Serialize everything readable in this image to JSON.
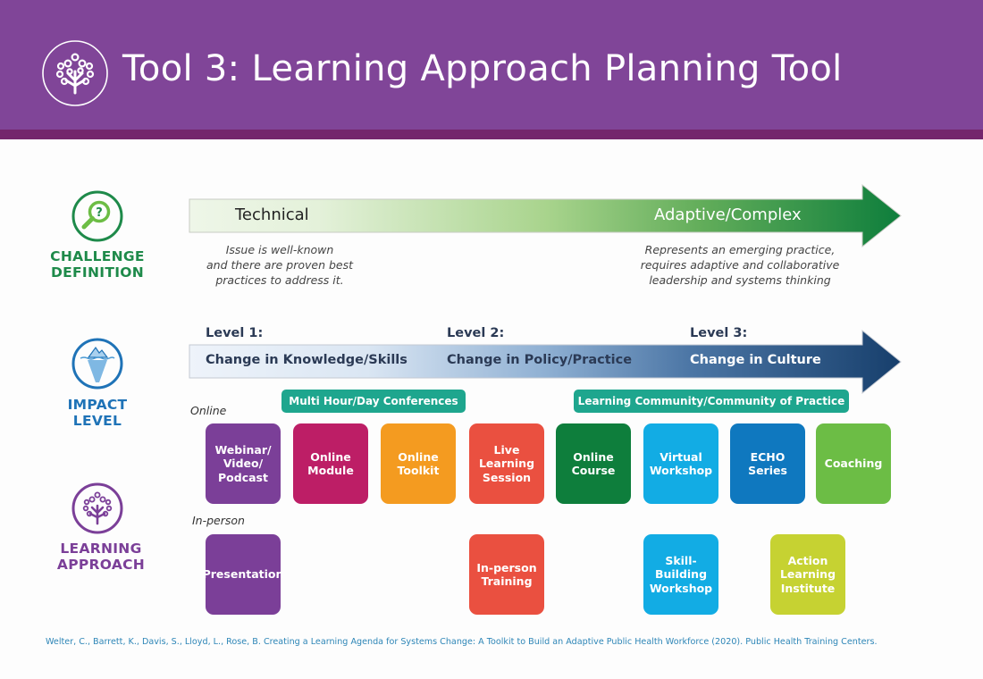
{
  "header": {
    "title": "Tool 3: Learning Approach Planning Tool",
    "logo_icon": "tree-of-gears-icon",
    "bg_color": "#804598",
    "band_color": "#74266c"
  },
  "rows": {
    "challenge": {
      "label_line1": "CHALLENGE",
      "label_line2": "DEFINITION",
      "icon": "magnifier-question-icon",
      "color": "#1e8a4a"
    },
    "impact": {
      "label_line1": "IMPACT",
      "label_line2": "LEVEL",
      "icon": "iceberg-icon",
      "color": "#1f73b7"
    },
    "learning": {
      "label_line1": "LEARNING",
      "label_line2": "APPROACH",
      "icon": "tree-of-gears-icon",
      "color": "#7b3f98"
    }
  },
  "challenge_arrow": {
    "left_label": "Technical",
    "right_label": "Adaptive/Complex",
    "left_desc": [
      "Issue is well-known",
      "and there are proven best",
      "practices to address it."
    ],
    "right_desc": [
      "Represents an emerging practice,",
      "requires adaptive and collaborative",
      "leadership and systems thinking"
    ],
    "gradient": [
      "#eef6e8",
      "#a9d48d",
      "#0e7e3c"
    ]
  },
  "impact_arrow": {
    "levels": [
      {
        "title": "Level 1:",
        "subtitle": "Change in Knowledge/Skills"
      },
      {
        "title": "Level 2:",
        "subtitle": "Change in Policy/Practice"
      },
      {
        "title": "Level 3:",
        "subtitle": "Change in Culture"
      }
    ],
    "gradient": [
      "#eef3fa",
      "#8fb0d3",
      "#173f6c"
    ]
  },
  "bands": [
    {
      "label": "Multi Hour/Day Conferences"
    },
    {
      "label": "Learning Community/Community of Practice"
    }
  ],
  "modes": {
    "online": "Online",
    "in_person": "In-person"
  },
  "online_approaches": [
    {
      "lines": [
        "Webinar/",
        "Video/",
        "Podcast"
      ],
      "color": "#7b3f98"
    },
    {
      "lines": [
        "Online",
        "Module"
      ],
      "color": "#bd1e66"
    },
    {
      "lines": [
        "Online",
        "Toolkit"
      ],
      "color": "#f49b20"
    },
    {
      "lines": [
        "Live",
        "Learning",
        "Session"
      ],
      "color": "#ea5040"
    },
    {
      "lines": [
        "Online",
        "Course"
      ],
      "color": "#0e7e3c"
    },
    {
      "lines": [
        "Virtual",
        "Workshop"
      ],
      "color": "#12ace4"
    },
    {
      "lines": [
        "ECHO",
        "Series"
      ],
      "color": "#0f78bf"
    },
    {
      "lines": [
        "Coaching"
      ],
      "color": "#6cbd45"
    }
  ],
  "in_person_approaches": [
    {
      "lines": [
        "Presentation"
      ],
      "color": "#7b3f98"
    },
    {
      "lines": [
        "In-person",
        "Training"
      ],
      "color": "#ea5040"
    },
    {
      "lines": [
        "Skill-",
        "Building",
        "Workshop"
      ],
      "color": "#12ace4"
    },
    {
      "lines": [
        "Action",
        "Learning",
        "Institute"
      ],
      "color": "#c6d232"
    }
  ],
  "citation": "Welter, C., Barrett, K., Davis, S., Lloyd, L., Rose, B. Creating a Learning Agenda for Systems Change: A Toolkit to Build an Adaptive Public Health Workforce (2020). Public Health Training Centers."
}
